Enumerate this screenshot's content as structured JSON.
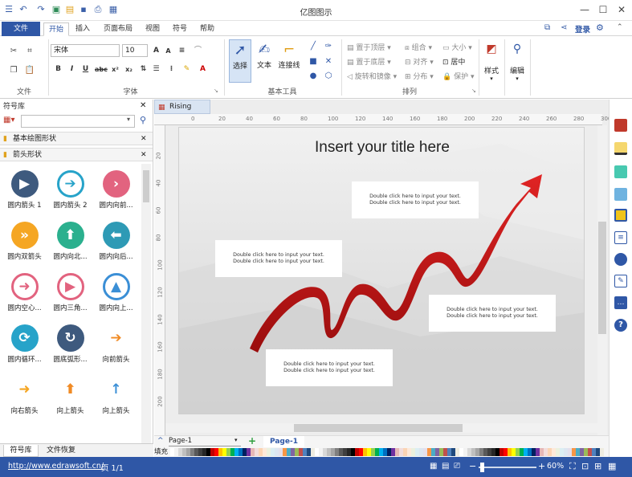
{
  "app": {
    "title": "亿图图示",
    "login_label": "登录"
  },
  "ribbon_tabs": [
    "文件",
    "开始",
    "插入",
    "页面布局",
    "视图",
    "符号",
    "帮助"
  ],
  "font": {
    "family": "宋体",
    "size": "10"
  },
  "groups": {
    "file": "文件",
    "font": "字体",
    "basic_tools": "基本工具",
    "arrange": "排列"
  },
  "tools": {
    "select": "选择",
    "text": "文本",
    "connector": "连接线",
    "style": "样式",
    "edit": "编辑"
  },
  "arrange": {
    "bring_top": "置于顶层",
    "send_bottom": "置于底层",
    "rotate_mirror": "旋转和镜像",
    "group": "组合",
    "align": "对齐",
    "distribute": "分布",
    "size": "大小",
    "center": "居中",
    "protect": "保护"
  },
  "panel": {
    "title": "符号库",
    "libraries": [
      "基本绘图形状",
      "箭头形状"
    ],
    "shapes": [
      {
        "label": "圆内箭头 1",
        "icon": "play-icon",
        "color": "#3e5a7e"
      },
      {
        "label": "圆内箭头 2",
        "icon": "arrow-right-icon",
        "color": "#27a3c9"
      },
      {
        "label": "圆内向前...",
        "icon": "chevron-right-icon",
        "color": "#e2637f"
      },
      {
        "label": "圆内双箭头",
        "icon": "double-chevron-icon",
        "color": "#f5a623"
      },
      {
        "label": "圆内向北...",
        "icon": "arrow-up-icon",
        "color": "#2bb08e"
      },
      {
        "label": "圆内向后...",
        "icon": "arrow-left-icon",
        "color": "#2e9ab5"
      },
      {
        "label": "圆内空心...",
        "icon": "arrow-right-outline-icon",
        "color": "#e2637f"
      },
      {
        "label": "圆内三角...",
        "icon": "play-outline-icon",
        "color": "#e2637f"
      },
      {
        "label": "圆内向上...",
        "icon": "triangle-up-icon",
        "color": "#3b8fd6"
      },
      {
        "label": "圆内循环...",
        "icon": "cycle-icon",
        "color": "#27a3c9"
      },
      {
        "label": "圆底弧形...",
        "icon": "arc-arrow-icon",
        "color": "#3e5a7e"
      },
      {
        "label": "向前箭头",
        "icon": "arrow-forward-icon",
        "color": "#f08a24"
      },
      {
        "label": "向右箭头",
        "icon": "arrow-right-plain-icon",
        "color": "#f5a623"
      },
      {
        "label": "向上箭头",
        "icon": "arrow-up-plain-icon",
        "color": "#f08a24"
      },
      {
        "label": "向上箭头",
        "icon": "arrow-up-thin-icon",
        "color": "#3b8fd6"
      }
    ],
    "bottom_tabs": [
      "符号库",
      "文件恢复"
    ]
  },
  "document": {
    "tab": "Rising",
    "title": "Insert your title here",
    "textbox_line1": "Double click here to input your text.",
    "textbox_line2": "Double click here to input your text.",
    "ruler_h": [
      "0",
      "20",
      "40",
      "60",
      "80",
      "100",
      "120",
      "140",
      "160",
      "180",
      "200",
      "220",
      "240",
      "260",
      "280",
      "300"
    ],
    "ruler_v": [
      "20",
      "40",
      "60",
      "80",
      "100",
      "120",
      "140",
      "160",
      "180",
      "200"
    ]
  },
  "pagebar": {
    "page_select": "Page-1",
    "page_tab": "Page-1"
  },
  "colorbar": {
    "fill_label": "填充"
  },
  "status": {
    "url": "http://www.edrawsoft.cn/",
    "page": "页 1/1",
    "zoom": "60%"
  }
}
